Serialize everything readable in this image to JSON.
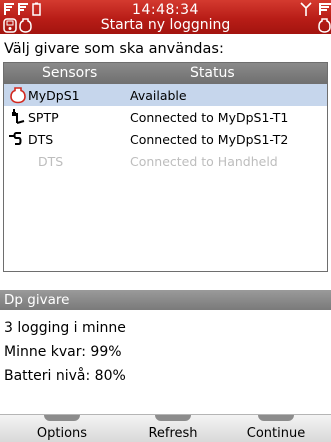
{
  "header": {
    "time": "14:48:34",
    "subtitle": "Starta ny loggning",
    "icons": {
      "top_left": [
        "signal-flag-icon",
        "signal-flag-icon",
        "battery-icon",
        "handheld-icon",
        "sensor-outline-icon"
      ],
      "top_right": [
        "antenna-icon",
        "signal-flag-icon",
        "sensor-outline-icon"
      ]
    }
  },
  "prompt": "Välj givare som ska användas:",
  "list": {
    "columns": [
      "Sensors",
      "Status"
    ],
    "rows": [
      {
        "icon": "sensor-red-outline-icon",
        "name": "MyDpS1",
        "status": "Available",
        "selected": true,
        "disabled": false
      },
      {
        "icon": "probe-icon",
        "name": "SPTP",
        "status": "Connected to MyDpS1-T1",
        "selected": false,
        "disabled": false
      },
      {
        "icon": "cable-probe-icon",
        "name": "DTS",
        "status": "Connected to MyDpS1-T2",
        "selected": false,
        "disabled": false
      },
      {
        "icon": "",
        "name": "DTS",
        "status": "Connected to Handheld",
        "selected": false,
        "disabled": true
      }
    ]
  },
  "detail": {
    "title": "Dp givare",
    "lines": [
      "3 logging i minne",
      "Minne kvar: 99%",
      "Batteri nivå: 80%"
    ]
  },
  "softkeys": [
    "Options",
    "Refresh",
    "Continue"
  ],
  "colors": {
    "titlebar": "#c0261f",
    "selected_row": "#c6d6ec",
    "header_gray": "#7a7a7a"
  }
}
